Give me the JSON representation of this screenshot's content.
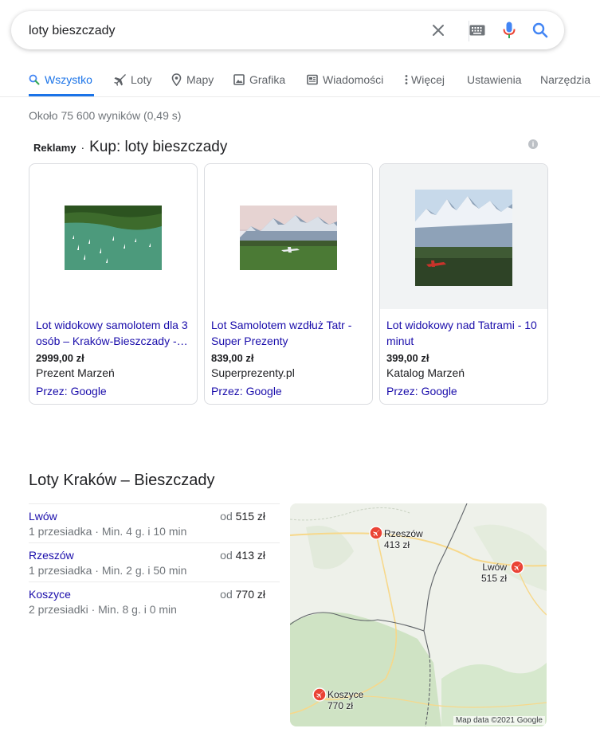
{
  "search": {
    "query": "loty bieszczady"
  },
  "colors": {
    "link": "#1a0dab",
    "accent": "#1a73e8",
    "mic_blue": "#4285f4",
    "mic_red": "#ea4335",
    "plane_marker": "#ea4335"
  },
  "tabs": [
    {
      "label": "Wszystko",
      "icon": "search-icon"
    },
    {
      "label": "Loty",
      "icon": "plane-icon"
    },
    {
      "label": "Mapy",
      "icon": "map-pin-icon"
    },
    {
      "label": "Grafika",
      "icon": "image-icon"
    },
    {
      "label": "Wiadomości",
      "icon": "news-icon"
    },
    {
      "label": "Więcej",
      "icon": "more-vert-icon"
    },
    {
      "label": "Ustawienia"
    },
    {
      "label": "Narzędzia"
    }
  ],
  "result_stats": "Około 75 600 wyników (0,49 s)",
  "ads": {
    "label": "Reklamy",
    "separator": "·",
    "title": "Kup: loty bieszczady",
    "info_icon": "i",
    "cards": [
      {
        "title": "Lot widokowy samolotem dla 3 osób – Kraków-Bieszczady -…",
        "price": "2999,00 zł",
        "merchant": "Prezent Marzeń",
        "via": "Przez: Google"
      },
      {
        "title": "Lot Samolotem wzdłuż Tatr - Super Prezenty",
        "price": "839,00 zł",
        "merchant": "Superprezenty.pl",
        "via": "Przez: Google"
      },
      {
        "title": "Lot widokowy nad Tatrami - 10 minut",
        "price": "399,00 zł",
        "merchant": "Katalog Marzeń",
        "via": "Przez: Google"
      }
    ]
  },
  "flights": {
    "title": "Loty Kraków – Bieszczady",
    "rows": [
      {
        "city": "Lwów",
        "detail": "1 przesiadka · Min. 4 g. i 10 min",
        "from": "od",
        "price": "515 zł"
      },
      {
        "city": "Rzeszów",
        "detail": "1 przesiadka · Min. 2 g. i 50 min",
        "from": "od",
        "price": "413 zł"
      },
      {
        "city": "Koszyce",
        "detail": "2 przesiadki · Min. 8 g. i 0 min",
        "from": "od",
        "price": "770 zł"
      }
    ],
    "map": {
      "markers": [
        {
          "city": "Rzeszów",
          "price": "413 zł"
        },
        {
          "city": "Lwów",
          "price": "515 zł"
        },
        {
          "city": "Koszyce",
          "price": "770 zł"
        }
      ],
      "credit": "Map data ©2021 Google"
    }
  }
}
